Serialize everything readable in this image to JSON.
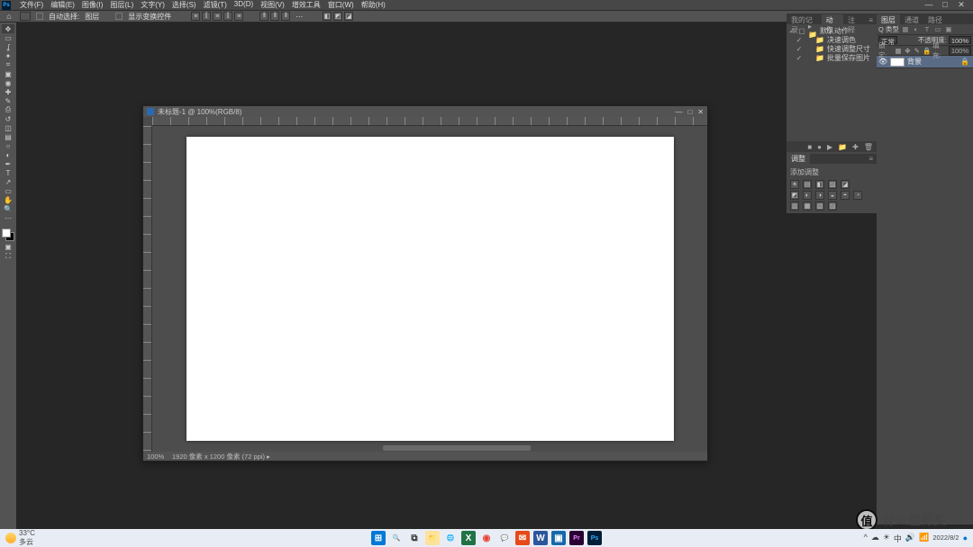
{
  "app": {
    "name": "Ps"
  },
  "menu": [
    "文件(F)",
    "编辑(E)",
    "图像(I)",
    "图层(L)",
    "文字(Y)",
    "选择(S)",
    "滤镜(T)",
    "3D(D)",
    "视图(V)",
    "增效工具",
    "窗口(W)",
    "帮助(H)"
  ],
  "window_controls": {
    "min": "—",
    "max": "□",
    "close": "✕"
  },
  "options_bar": {
    "auto_select_label": "自动选择:",
    "layer_label": "图层",
    "transform_label": "显示变换控件",
    "more": "⋯"
  },
  "tools": [
    "move",
    "rect-marquee",
    "lasso",
    "magic-wand",
    "crop",
    "frame",
    "eyedropper",
    "healing",
    "brush",
    "stamp",
    "history-brush",
    "eraser",
    "gradient",
    "blur",
    "dodge",
    "pen",
    "type",
    "path-select",
    "shape",
    "hand",
    "zoom",
    "more"
  ],
  "tool_glyph_map": {
    "move": "g-move",
    "rect-marquee": "g-rect",
    "lasso": "g-lasso",
    "magic-wand": "g-wand",
    "crop": "g-crop",
    "frame": "g-frame",
    "eyedropper": "g-eyed",
    "healing": "g-heal",
    "brush": "g-brush",
    "stamp": "g-stamp",
    "history-brush": "g-hist",
    "eraser": "g-eras",
    "gradient": "g-grad",
    "blur": "g-blur",
    "dodge": "g-dodge",
    "pen": "g-pen",
    "type": "g-type",
    "path-select": "g-path",
    "shape": "g-shape",
    "hand": "g-hand",
    "zoom": "g-zoom",
    "more": "g-dots"
  },
  "doc": {
    "title": "未标题-1 @ 100%(RGB/8)",
    "zoom": "100%",
    "status": "1920 像素 x 1200 像素 (72 ppi)",
    "win": {
      "min": "—",
      "max": "□",
      "close": "✕"
    }
  },
  "actions_panel": {
    "tabs": [
      "我的记录",
      "动作",
      "注释"
    ],
    "active_tab": 1,
    "items": [
      {
        "check": "✓",
        "dot": "▢",
        "icon": "▸ 📁",
        "label": "默认动作"
      },
      {
        "check": "✓",
        "dot": "",
        "icon": "📁",
        "label": "决速调色"
      },
      {
        "check": "✓",
        "dot": "",
        "icon": "📁",
        "label": "快速调整尺寸"
      },
      {
        "check": "✓",
        "dot": "",
        "icon": "📁",
        "label": "批量保存图片"
      }
    ],
    "footer_icons": [
      "■",
      "●",
      "▶",
      "📁",
      "✚",
      "🗑"
    ]
  },
  "adjustments_panel": {
    "tab": "调整",
    "header": "添加调整",
    "rows": [
      [
        "☀",
        "▤",
        "◧",
        "▨",
        "◪"
      ],
      [
        "◩",
        "◐",
        "◑",
        "◒",
        "◓",
        "◔"
      ],
      [
        "▥",
        "▦",
        "▧",
        "▨"
      ]
    ]
  },
  "layers_panel": {
    "tabs": [
      "图层",
      "通道",
      "路径"
    ],
    "active_tab": 0,
    "kind_label": "Q 类型",
    "blend_mode": "正常",
    "opacity_label": "不透明度:",
    "opacity_value": "100%",
    "lock_label": "锁定:",
    "fill_label": "填充:",
    "fill_value": "100%",
    "layer_name": "背景",
    "eye": "👁",
    "lock_icon": "🔒"
  },
  "taskbar": {
    "weather_temp": "33°C",
    "weather_desc": "多云",
    "apps": [
      {
        "name": "start",
        "bg": "#0078d4",
        "glyph": "⊞",
        "color": "#fff"
      },
      {
        "name": "search",
        "bg": "transparent",
        "glyph": "🔍",
        "color": "#333"
      },
      {
        "name": "taskview",
        "bg": "transparent",
        "glyph": "⧉",
        "color": "#333"
      },
      {
        "name": "explorer",
        "bg": "#ffe29a",
        "glyph": "📁",
        "color": "#333"
      },
      {
        "name": "edge",
        "bg": "transparent",
        "glyph": "🌐",
        "color": "#1e88e5"
      },
      {
        "name": "excel",
        "bg": "#217346",
        "glyph": "X",
        "color": "#fff"
      },
      {
        "name": "chrome",
        "bg": "transparent",
        "glyph": "◉",
        "color": "#ea4335"
      },
      {
        "name": "chat",
        "bg": "transparent",
        "glyph": "💬",
        "color": "#5b5fc7"
      },
      {
        "name": "mail",
        "bg": "#e64a19",
        "glyph": "✉",
        "color": "#fff"
      },
      {
        "name": "word",
        "bg": "#2b579a",
        "glyph": "W",
        "color": "#fff"
      },
      {
        "name": "app1",
        "bg": "#1769aa",
        "glyph": "▣",
        "color": "#fff"
      },
      {
        "name": "pr",
        "bg": "#2a0033",
        "glyph": "Pr",
        "color": "#e48aff"
      },
      {
        "name": "ps",
        "bg": "#001e36",
        "glyph": "Ps",
        "color": "#31a8ff"
      }
    ],
    "tray_icons": [
      "^",
      "☁",
      "☀",
      "中",
      "🔊",
      "📶"
    ],
    "date": "2022/8/2"
  },
  "watermark": {
    "badge": "值",
    "text": "什么值得买"
  }
}
